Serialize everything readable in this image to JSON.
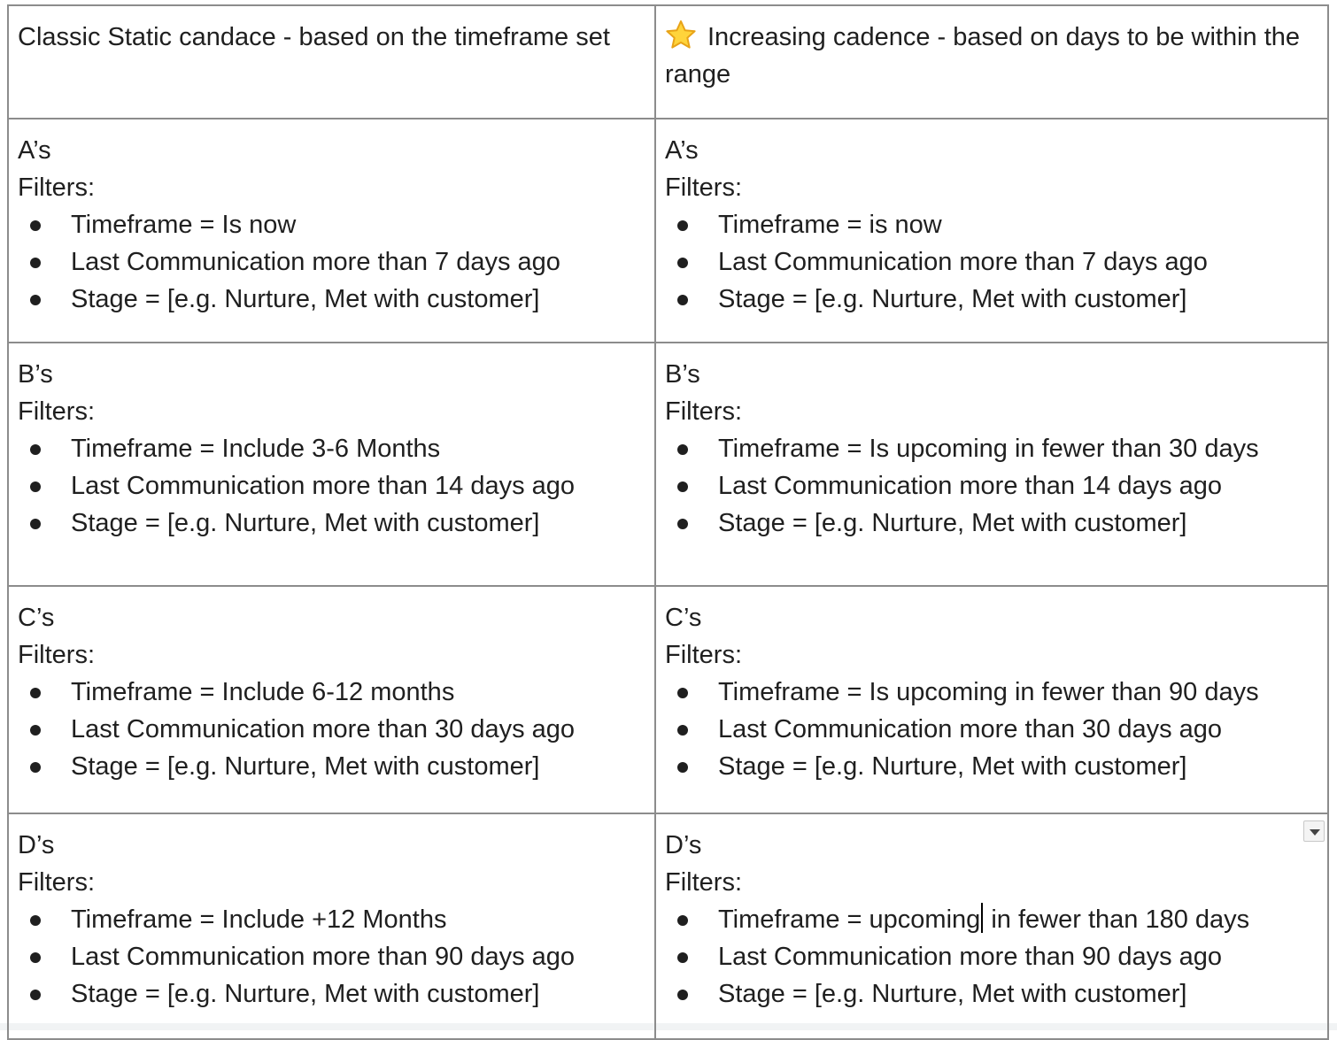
{
  "header": {
    "left": "Classic Static candace - based on the timeframe set",
    "right_icon": "star-icon",
    "right": "Increasing cadence - based on days to be within the range"
  },
  "filters_label": "Filters:",
  "rows": [
    {
      "left": {
        "title": "A’s",
        "items": [
          "Timeframe = Is now",
          "Last Communication more than 7 days ago",
          "Stage = [e.g. Nurture, Met with customer]"
        ]
      },
      "right": {
        "title": "A’s",
        "items": [
          "Timeframe = is now",
          "Last Communication more than 7 days ago",
          "Stage = [e.g. Nurture, Met with customer]"
        ]
      }
    },
    {
      "left": {
        "title": "B’s",
        "items": [
          "Timeframe = Include 3-6 Months",
          "Last Communication more than 14 days ago",
          "Stage = [e.g. Nurture, Met with customer]"
        ]
      },
      "right": {
        "title": "B’s",
        "items": [
          "Timeframe = Is upcoming in fewer than 30 days",
          "Last Communication more than 14 days ago",
          "Stage = [e.g. Nurture, Met with customer]"
        ]
      }
    },
    {
      "left": {
        "title": "C’s",
        "items": [
          "Timeframe = Include 6-12 months",
          "Last Communication more than 30 days ago",
          "Stage = [e.g. Nurture, Met with customer]"
        ]
      },
      "right": {
        "title": "C’s",
        "items": [
          "Timeframe = Is upcoming in fewer than 90 days",
          "Last Communication more than 30 days ago",
          "Stage = [e.g. Nurture, Met with customer]"
        ]
      }
    },
    {
      "left": {
        "title": "D’s",
        "items": [
          "Timeframe = Include +12 Months",
          "Last Communication more than 90 days ago",
          "Stage = [e.g. Nurture, Met with customer]"
        ]
      },
      "right": {
        "title": "D’s",
        "items": [
          "Timeframe = upcoming",
          "Last Communication more than 90 days ago",
          "Stage = [e.g. Nurture, Met with customer]"
        ],
        "item0_after_cursor": " in fewer than 180 days",
        "menu_icon": "dropdown-arrow-icon"
      }
    }
  ]
}
